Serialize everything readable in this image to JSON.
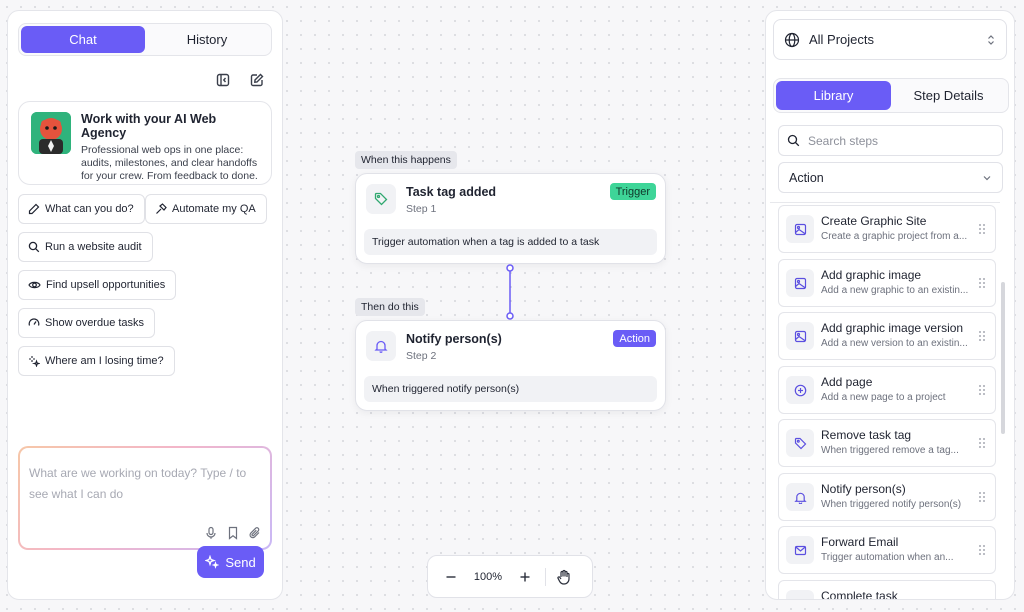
{
  "chat_panel": {
    "tabs": [
      {
        "label": "Chat",
        "active": true
      },
      {
        "label": "History",
        "active": false
      }
    ],
    "agency_card": {
      "title": "Work with your AI Web Agency",
      "description": "Professional web ops in one place: audits, milestones, and clear handoffs for your crew. From feedback to done."
    },
    "suggestions": [
      {
        "label": "What can you do?",
        "icon": "pencil-icon"
      },
      {
        "label": "Automate my QA",
        "icon": "hammer-icon"
      },
      {
        "label": "Run a website audit",
        "icon": "search-icon"
      },
      {
        "label": "Find upsell opportunities",
        "icon": "eye-icon"
      },
      {
        "label": "Show overdue tasks",
        "icon": "gauge-icon"
      },
      {
        "label": "Where am I losing time?",
        "icon": "sparkle-icon"
      }
    ],
    "composer": {
      "placeholder": "What are we working on today? Type / to see what I can do"
    },
    "send_label": "Send"
  },
  "canvas": {
    "trigger_phase_label": "When this happens",
    "action_phase_label": "Then do this",
    "nodes": [
      {
        "title": "Task tag added",
        "step": "Step 1",
        "badge": "Trigger",
        "description": "Trigger automation when a tag is added to a task",
        "icon": "tag-icon"
      },
      {
        "title": "Notify person(s)",
        "step": "Step 2",
        "badge": "Action",
        "description": "When triggered notify person(s)",
        "icon": "bell-icon"
      }
    ],
    "zoom": "100%"
  },
  "library_panel": {
    "project_selector": "All Projects",
    "tabs": [
      {
        "label": "Library",
        "active": true
      },
      {
        "label": "Step Details",
        "active": false
      }
    ],
    "search_placeholder": "Search steps",
    "type_filter": "Action",
    "steps": [
      {
        "title": "Create Graphic Site",
        "subtitle": "Create a graphic project from a...",
        "icon": "image-icon"
      },
      {
        "title": "Add graphic image",
        "subtitle": "Add a new graphic to an existin...",
        "icon": "image-icon"
      },
      {
        "title": "Add graphic image version",
        "subtitle": "Add a new version to an existin...",
        "icon": "image-icon"
      },
      {
        "title": "Add page",
        "subtitle": "Add a new page to a project",
        "icon": "plus-circle-icon"
      },
      {
        "title": "Remove task tag",
        "subtitle": "When triggered remove a tag...",
        "icon": "tag-icon"
      },
      {
        "title": "Notify person(s)",
        "subtitle": "When triggered notify person(s)",
        "icon": "bell-icon"
      },
      {
        "title": "Forward Email",
        "subtitle": "Trigger automation when an...",
        "icon": "mail-icon"
      },
      {
        "title": "Complete task",
        "subtitle": "",
        "icon": "check-icon"
      }
    ]
  },
  "colors": {
    "accent": "#6a5cf6",
    "trigger_badge_bg": "#3ed598",
    "action_badge_bg": "#6a5cf6"
  }
}
